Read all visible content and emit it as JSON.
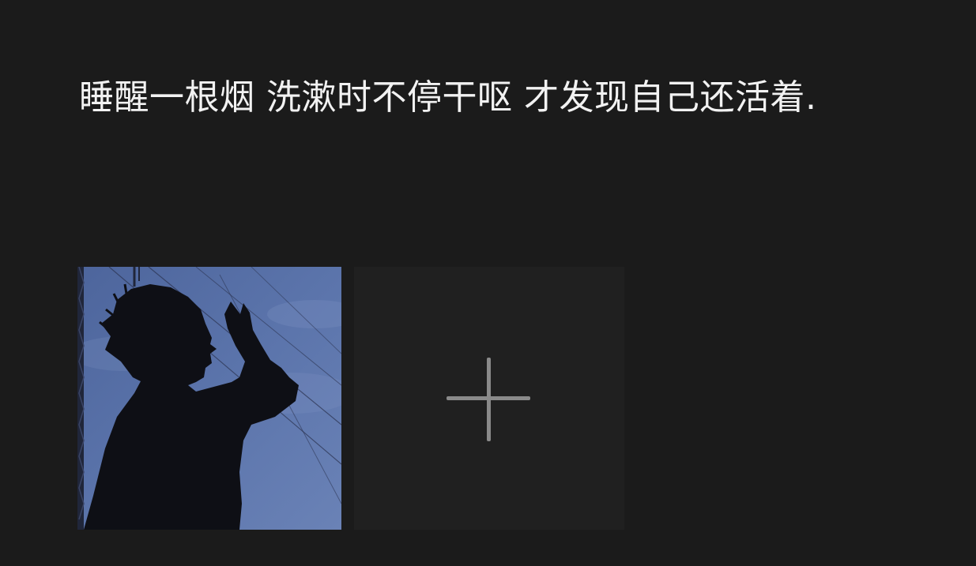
{
  "post": {
    "text": "睡醒一根烟 洗漱时不停干呕 才发现自己还活着."
  },
  "images": [
    {
      "subject": "silhouette-person-raising-hand",
      "palette": [
        "#5b73a8",
        "#3f5488",
        "#101014"
      ]
    }
  ],
  "add_image": {
    "icon": "plus-icon"
  },
  "colors": {
    "background": "#1b1b1b",
    "text": "#f2f2f2",
    "add_tile": "#202020",
    "plus": "#8a8a8a"
  }
}
